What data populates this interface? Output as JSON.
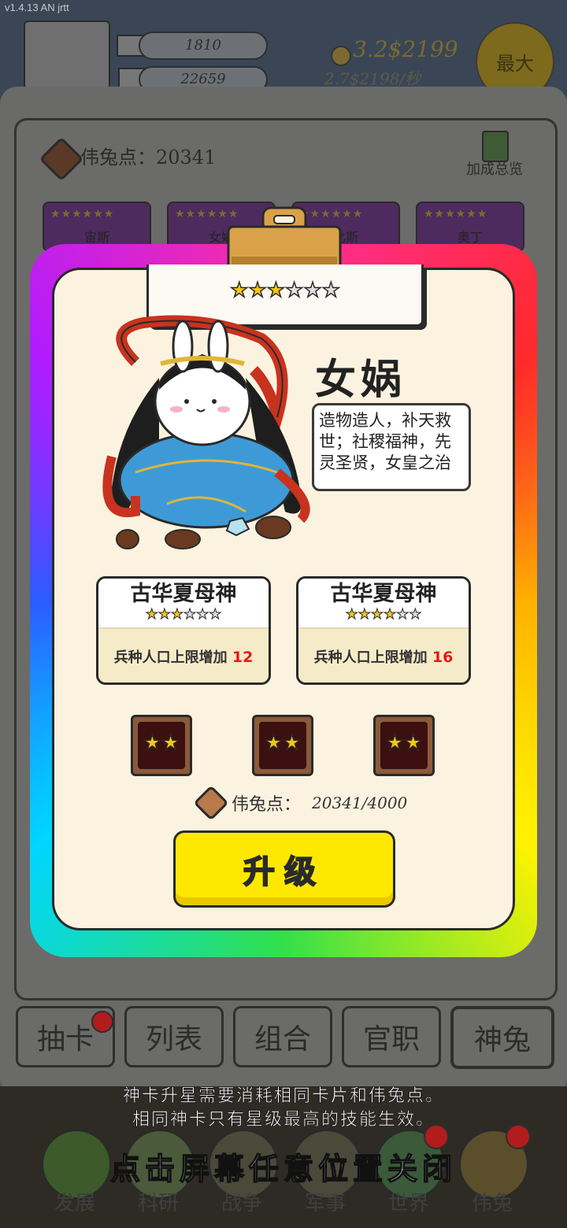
{
  "status": {
    "version": "v1.4.13 AN jrtt"
  },
  "header": {
    "resource1": "1810",
    "resource2": "22659",
    "gold_main": "3.2$2199",
    "gold_rate": "2.7$2198/秒",
    "max_button": "最大"
  },
  "background_panel": {
    "points_label": "伟兔点：20341",
    "bonus_overview": "加成总览",
    "card_names": [
      "宙斯",
      "女娲",
      "比斯",
      "奥丁"
    ]
  },
  "modal": {
    "star_rating": {
      "filled": 3,
      "total": 6
    },
    "card_name": "女娲",
    "description": "造物造人，补天救世；社稷福神，先灵圣贤，女皇之治",
    "skills": [
      {
        "title": "古华夏母神",
        "stars_filled": 3,
        "stars_total": 6,
        "desc": "兵种人口上限增加",
        "value": "12"
      },
      {
        "title": "古华夏母神",
        "stars_filled": 4,
        "stars_total": 6,
        "desc": "兵种人口上限增加",
        "value": "16"
      }
    ],
    "material_slots": [
      {
        "stars": 2
      },
      {
        "stars": 2
      },
      {
        "stars": 2
      }
    ],
    "points_label": "伟兔点：",
    "points_value": "20341/4000",
    "upgrade_button": "升级"
  },
  "tabs": [
    "抽卡",
    "列表",
    "组合",
    "官职",
    "神兔"
  ],
  "bottom_nav": [
    "发展",
    "科研",
    "战争",
    "军事",
    "世界",
    "伟兔"
  ],
  "hints": {
    "line1": "神卡升星需要消耗相同卡片和伟兔点。",
    "line2": "相同神卡只有星级最高的技能生效。",
    "close": "点击屏幕任意位置关闭"
  },
  "colors": {
    "star_on": "#f6c619",
    "upgrade_button": "#ffe800",
    "skill_value": "#e21b1b",
    "overlay": "#5c5c5c"
  }
}
